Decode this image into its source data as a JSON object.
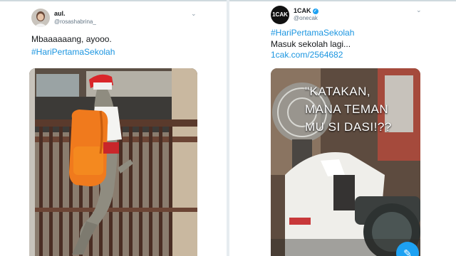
{
  "left_tweet": {
    "display_name": "aul.",
    "handle": "@rosashabrina_",
    "text_line1": "Mbaaaaaang, ayooo.",
    "hashtag": "#HariPertamaSekolah"
  },
  "right_tweet": {
    "display_name": "1CAK",
    "handle": "@onecak",
    "avatar_text": "1CAK",
    "hashtag": "#HariPertamaSekolah",
    "text_line2": "Masuk sekolah lagi...",
    "link": "1cak.com/2564682",
    "image_caption": "\"KATAKAN,\nMANA TEMAN\nMU SI DASI!??"
  },
  "icons": {
    "menu": "chevron-down-icon",
    "verified": "verified-badge-icon",
    "compose": "compose-fab-icon"
  },
  "colors": {
    "link_blue": "#1b95e0",
    "verified_blue": "#1da1f2",
    "page_bg": "#e6ecf0"
  }
}
